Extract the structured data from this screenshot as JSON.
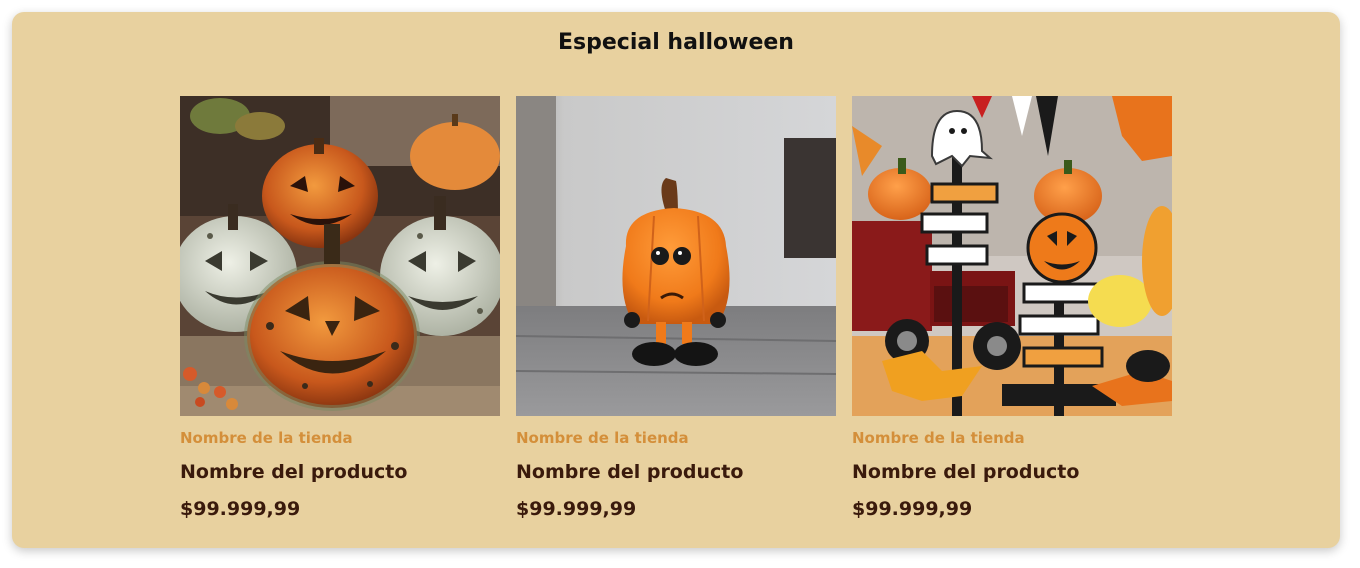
{
  "section": {
    "title": "Especial halloween"
  },
  "products": [
    {
      "store": "Nombre de la tienda",
      "name": "Nombre del producto",
      "price": "$99.999,99",
      "image": "ceramic-jack-o-lantern-pumpkins"
    },
    {
      "store": "Nombre de la tienda",
      "name": "Nombre del producto",
      "price": "$99.999,99",
      "image": "orange-pumpkin-figurine"
    },
    {
      "store": "Nombre de la tienda",
      "name": "Nombre del producto",
      "price": "$99.999,99",
      "image": "halloween-signpost-decor"
    }
  ],
  "theme": {
    "panel_bg": "#e8d19f",
    "store_color": "#d48f3a",
    "text_dark": "#3a1a0c"
  }
}
